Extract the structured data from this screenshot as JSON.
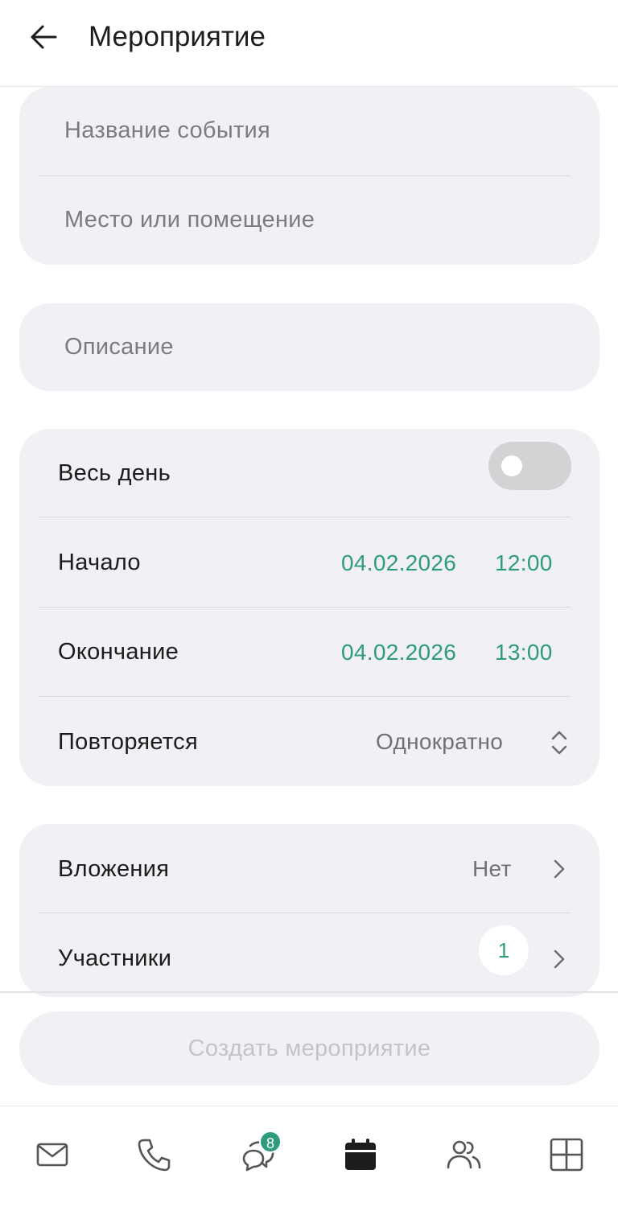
{
  "header": {
    "title": "Мероприятие"
  },
  "form": {
    "name_placeholder": "Название события",
    "place_placeholder": "Место или помещение",
    "description_placeholder": "Описание"
  },
  "schedule": {
    "all_day_label": "Весь день",
    "all_day_enabled": false,
    "start_label": "Начало",
    "start_date": "04.02.2026",
    "start_time": "12:00",
    "end_label": "Окончание",
    "end_date": "04.02.2026",
    "end_time": "13:00",
    "repeat_label": "Повторяется",
    "repeat_value": "Однократно"
  },
  "extras": {
    "attachments_label": "Вложения",
    "attachments_value": "Нет",
    "participants_label": "Участники",
    "participants_count": "1"
  },
  "actions": {
    "create_label": "Создать мероприятие"
  },
  "tabbar": {
    "items": [
      {
        "icon": "mail-icon"
      },
      {
        "icon": "phone-icon"
      },
      {
        "icon": "chat-icon",
        "badge": "8"
      },
      {
        "icon": "calendar-icon",
        "active": true
      },
      {
        "icon": "contacts-icon"
      },
      {
        "icon": "apps-icon"
      }
    ]
  },
  "colors": {
    "accent": "#2e9b7d",
    "card_bg": "#f1f1f5",
    "text": "#1c1c1c",
    "muted": "#707075"
  }
}
